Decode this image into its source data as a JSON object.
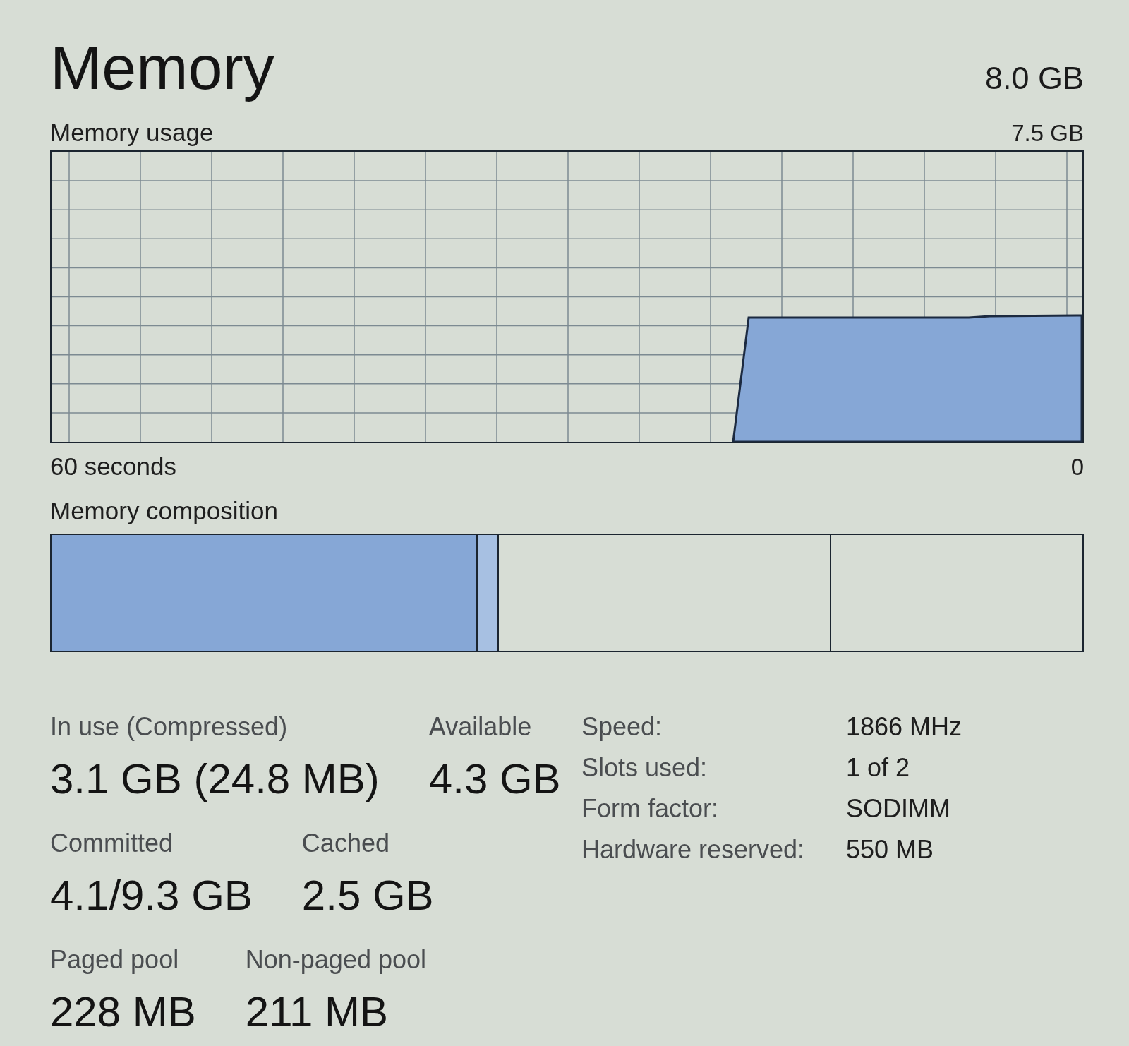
{
  "header": {
    "title": "Memory",
    "total": "8.0 GB"
  },
  "usage_chart": {
    "title": "Memory usage",
    "max_label": "7.5 GB",
    "start_label": "60 seconds",
    "end_label": "0"
  },
  "composition": {
    "title": "Memory composition"
  },
  "stat_rows": [
    [
      {
        "label": "In use (Compressed)",
        "value": "3.1 GB (24.8 MB)"
      },
      {
        "label": "Available",
        "value": "4.3 GB"
      }
    ],
    [
      {
        "label": "Committed",
        "value": "4.1/9.3 GB"
      },
      {
        "label": "Cached",
        "value": "2.5 GB"
      }
    ],
    [
      {
        "label": "Paged pool",
        "value": "228 MB"
      },
      {
        "label": "Non-paged pool",
        "value": "211 MB"
      }
    ]
  ],
  "properties": [
    {
      "label": "Speed:",
      "value": "1866 MHz"
    },
    {
      "label": "Slots used:",
      "value": "1 of 2"
    },
    {
      "label": "Form factor:",
      "value": "SODIMM"
    },
    {
      "label": "Hardware reserved:",
      "value": "550 MB"
    }
  ]
}
